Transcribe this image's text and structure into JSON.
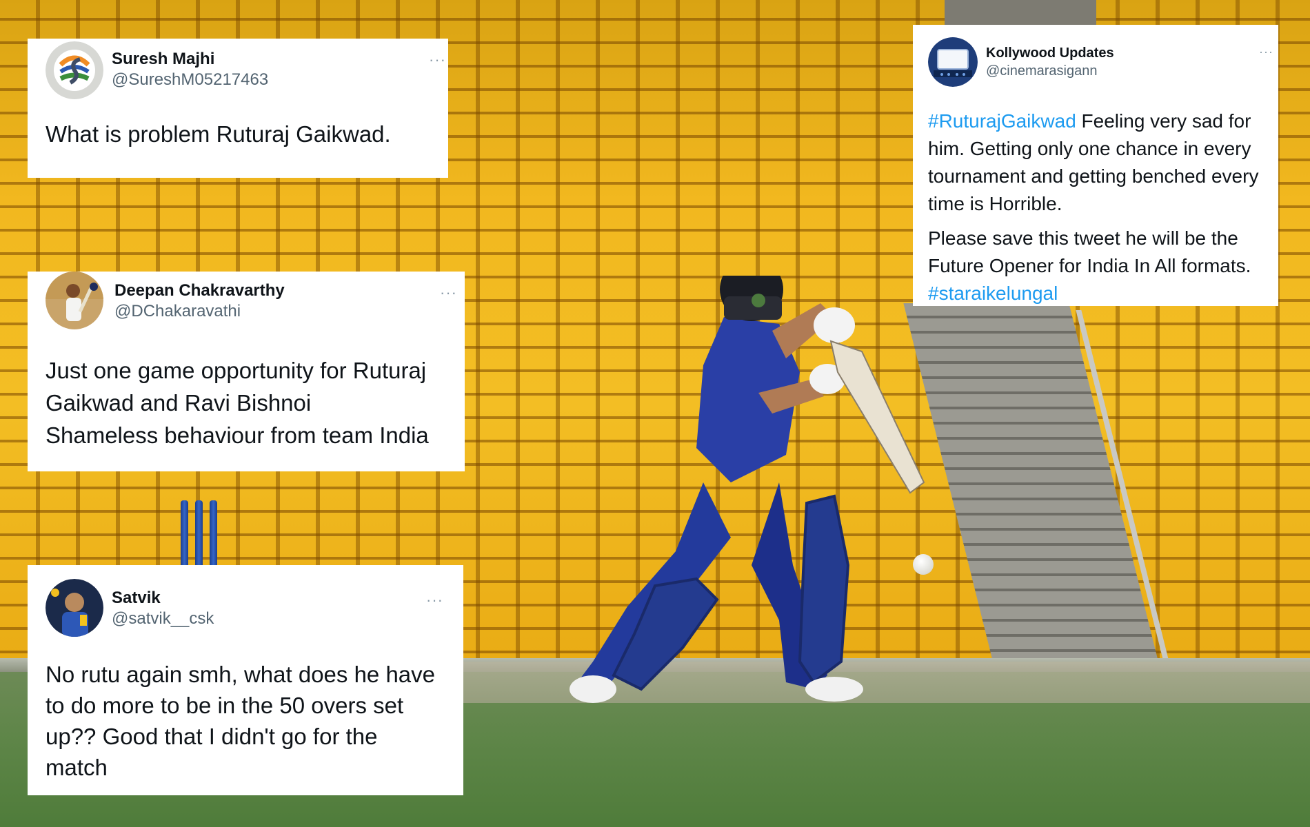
{
  "tweets": [
    {
      "name": "Suresh Majhi",
      "handle": "@SureshM05217463",
      "more": "···",
      "text": "What is problem Ruturaj Gaikwad."
    },
    {
      "name": "Deepan Chakravarthy",
      "handle": "@DChakaravathi",
      "more": "···",
      "lines": [
        "Just one game opportunity for Ruturaj",
        "Gaikwad and Ravi Bishnoi",
        "Shameless behaviour from team India"
      ]
    },
    {
      "name": "Satvik",
      "handle": "@satvik__csk",
      "more": "···",
      "lines": [
        "No rutu again smh, what does he have",
        "to do more to be in the 50 overs set",
        "up?? Good that I didn't go for the",
        "match"
      ]
    },
    {
      "name": "Kollywood Updates",
      "handle": "@cinemarasigann",
      "more": "···",
      "hashtag_open": "#RuturajGaikwad",
      "p1_rest": " Feeling very sad for him. Getting only one chance in every tournament and getting benched every time is Horrible.",
      "p2": "Please save this tweet he will be the Future Opener for India In All formats.",
      "hashtag_close": "#staraikelungal"
    }
  ],
  "colors": {
    "hashtag": "#1d9bf0",
    "handle": "#536471",
    "seats": "#f2b81f"
  },
  "icons": [
    "more-options-icon"
  ]
}
